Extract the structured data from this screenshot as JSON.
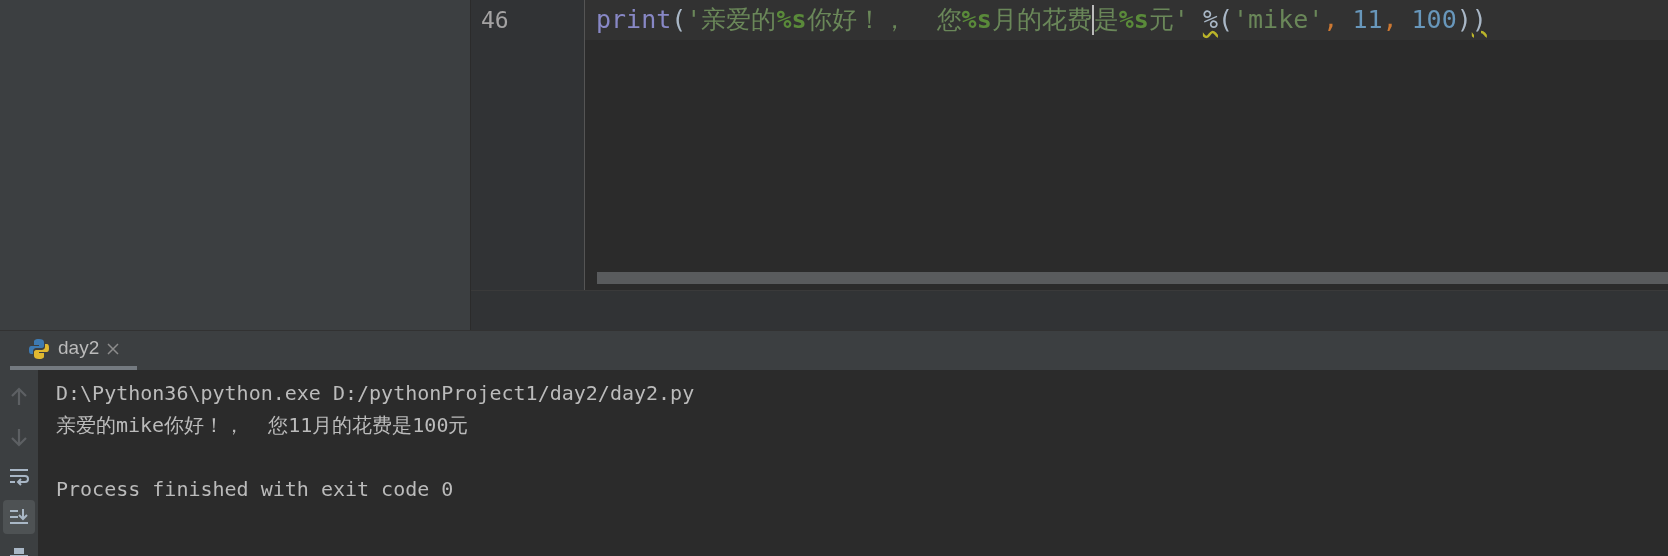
{
  "editor": {
    "line_number": "46",
    "tokens": [
      {
        "kind": "builtin",
        "text": "print",
        "warning": false
      },
      {
        "kind": "paren",
        "text": "(",
        "warning": false
      },
      {
        "kind": "string",
        "text": "'亲爱的",
        "warning": false
      },
      {
        "kind": "format",
        "text": "%s",
        "warning": false
      },
      {
        "kind": "string",
        "text": "你好！，  您",
        "warning": false
      },
      {
        "kind": "format",
        "text": "%s",
        "warning": false
      },
      {
        "kind": "string",
        "text": "月的花费",
        "warning": false
      },
      {
        "kind": "caret"
      },
      {
        "kind": "string",
        "text": "是",
        "warning": false
      },
      {
        "kind": "format",
        "text": "%s",
        "warning": false
      },
      {
        "kind": "string",
        "text": "元'",
        "warning": false
      },
      {
        "kind": "operator",
        "text": "%",
        "warning": true
      },
      {
        "kind": "paren",
        "text": "(",
        "warning": false
      },
      {
        "kind": "string",
        "text": "'mike'",
        "warning": false
      },
      {
        "kind": "comma",
        "text": ",",
        "warning": false
      },
      {
        "kind": "number",
        "text": "11",
        "warning": false
      },
      {
        "kind": "comma",
        "text": ",",
        "warning": false
      },
      {
        "kind": "number",
        "text": "100",
        "warning": false
      },
      {
        "kind": "paren",
        "text": ")",
        "warning": false
      },
      {
        "kind": "paren",
        "text": ")",
        "warning": true
      }
    ]
  },
  "run_panel": {
    "tabs": [
      {
        "label": "day2",
        "selected": true
      }
    ],
    "toolbar": [
      {
        "kind": "up",
        "active": false
      },
      {
        "kind": "down",
        "active": false
      },
      {
        "kind": "wrap",
        "active": false
      },
      {
        "kind": "scroll-end",
        "active": true
      },
      {
        "kind": "print",
        "active": false
      }
    ],
    "output": [
      "D:\\Python36\\python.exe D:/pythonProject1/day2/day2.py",
      "亲爱的mike你好！，  您11月的花费是100元"
    ],
    "exit_message": "Process finished with exit code 0"
  }
}
